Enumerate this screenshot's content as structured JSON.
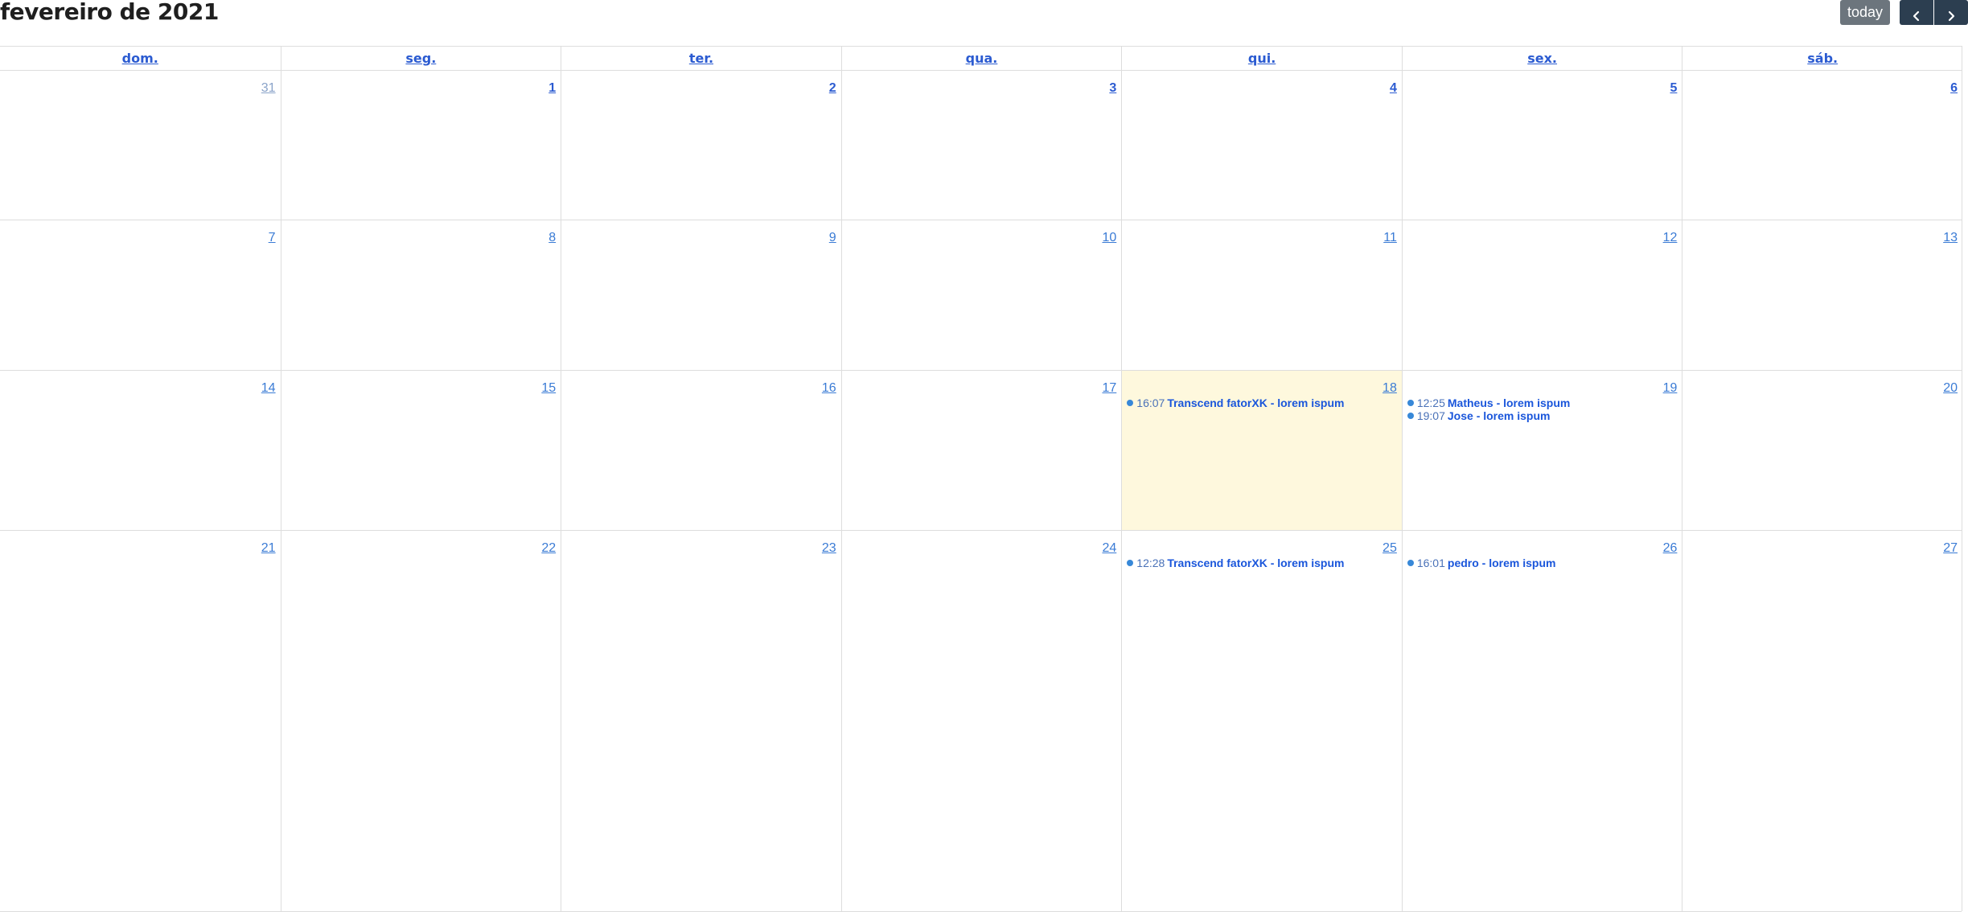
{
  "header": {
    "title": "fevereiro de 2021",
    "today_label": "today",
    "prev_icon": "chevron-left-icon",
    "next_icon": "chevron-right-icon"
  },
  "colors": {
    "today_bg": "#fef8dd",
    "event_dot": "#3788d8",
    "link": "#3a7bd5",
    "button_dark": "#2c3e50",
    "button_gray": "#6c757d"
  },
  "days_of_week": [
    "dom.",
    "seg.",
    "ter.",
    "qua.",
    "qui.",
    "sex.",
    "sáb."
  ],
  "weeks": [
    {
      "days": [
        {
          "num": "31",
          "other": true
        },
        {
          "num": "1",
          "bold": true
        },
        {
          "num": "2",
          "bold": true
        },
        {
          "num": "3",
          "bold": true
        },
        {
          "num": "4",
          "bold": true
        },
        {
          "num": "5",
          "bold": true
        },
        {
          "num": "6",
          "bold": true
        }
      ]
    },
    {
      "days": [
        {
          "num": "7"
        },
        {
          "num": "8"
        },
        {
          "num": "9"
        },
        {
          "num": "10"
        },
        {
          "num": "11"
        },
        {
          "num": "12"
        },
        {
          "num": "13"
        }
      ]
    },
    {
      "days": [
        {
          "num": "14"
        },
        {
          "num": "15"
        },
        {
          "num": "16"
        },
        {
          "num": "17"
        },
        {
          "num": "18",
          "today": true,
          "events": [
            {
              "time": "16:07",
              "title": "Transcend fatorXK - lorem ispum"
            }
          ]
        },
        {
          "num": "19",
          "events": [
            {
              "time": "12:25",
              "title": "Matheus - lorem ispum"
            },
            {
              "time": "19:07",
              "title": "Jose - lorem ispum"
            }
          ]
        },
        {
          "num": "20"
        }
      ]
    },
    {
      "days": [
        {
          "num": "21"
        },
        {
          "num": "22"
        },
        {
          "num": "23"
        },
        {
          "num": "24"
        },
        {
          "num": "25",
          "events": [
            {
              "time": "12:28",
              "title": "Transcend fatorXK - lorem ispum"
            }
          ]
        },
        {
          "num": "26",
          "events": [
            {
              "time": "16:01",
              "title": "pedro - lorem ispum"
            }
          ]
        },
        {
          "num": "27"
        }
      ]
    }
  ]
}
